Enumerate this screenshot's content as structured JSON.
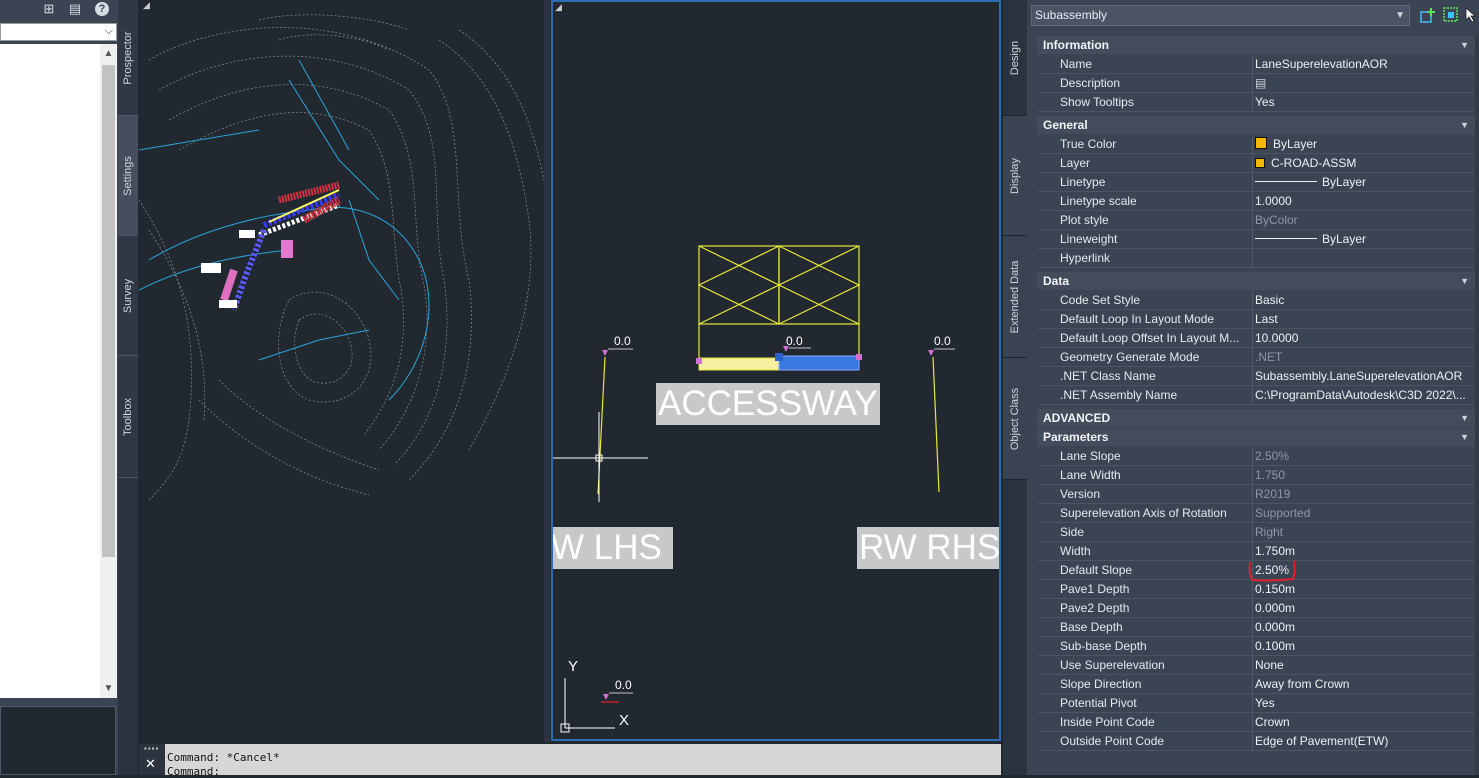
{
  "toolspace": {
    "tabs": [
      "Prospector",
      "Settings",
      "Survey",
      "Toolbox"
    ],
    "active_tab": "Settings",
    "toolbar_icons": [
      "toolbar-icon",
      "palette-icon",
      "help-icon"
    ],
    "help_glyph": "?",
    "combo_value": ""
  },
  "viewport_right": {
    "accessway_label": "ACCESSWAY",
    "lhs_label": "W LHS",
    "rhs_label": "RW RHS",
    "point_values": [
      "0.0",
      "0.0",
      "0.0",
      "0.0"
    ],
    "ucs": {
      "y": "Y",
      "x": "X"
    }
  },
  "command_line": {
    "line1": "Command: *Cancel*",
    "line2": "Command:",
    "close_glyph": "✕"
  },
  "palette_tabs": [
    "Design",
    "Display",
    "Extended Data",
    "Object Class"
  ],
  "properties": {
    "object_type": "Subassembly",
    "sections": {
      "information": {
        "title": "Information",
        "rows": [
          {
            "label": "Name",
            "value": "LaneSuperelevationAOR"
          },
          {
            "label": "Description",
            "value": ""
          },
          {
            "label": "Show Tooltips",
            "value": "Yes"
          }
        ]
      },
      "general": {
        "title": "General",
        "rows": [
          {
            "label": "True Color",
            "value": "ByLayer"
          },
          {
            "label": "Layer",
            "value": "C-ROAD-ASSM"
          },
          {
            "label": "Linetype",
            "value": "ByLayer"
          },
          {
            "label": "Linetype scale",
            "value": "1.0000"
          },
          {
            "label": "Plot style",
            "value": "ByColor"
          },
          {
            "label": "Lineweight",
            "value": "ByLayer"
          },
          {
            "label": "Hyperlink",
            "value": ""
          }
        ]
      },
      "data": {
        "title": "Data",
        "rows": [
          {
            "label": "Code Set Style",
            "value": "Basic"
          },
          {
            "label": "Default Loop In Layout Mode",
            "value": "Last"
          },
          {
            "label": "Default Loop Offset In Layout M...",
            "value": "10.0000"
          },
          {
            "label": "Geometry Generate Mode",
            "value": ".NET"
          },
          {
            "label": ".NET Class Name",
            "value": "Subassembly.LaneSuperelevationAOR"
          },
          {
            "label": ".NET Assembly Name",
            "value": "C:\\ProgramData\\Autodesk\\C3D 2022\\..."
          }
        ]
      },
      "advanced": {
        "title": "ADVANCED"
      },
      "parameters": {
        "title": "Parameters",
        "rows": [
          {
            "label": "Lane Slope",
            "value": "2.50%"
          },
          {
            "label": "Lane Width",
            "value": "1.750"
          },
          {
            "label": "Version",
            "value": "R2019"
          },
          {
            "label": "Superelevation Axis of Rotation",
            "value": "Supported"
          },
          {
            "label": "Side",
            "value": "Right"
          },
          {
            "label": "Width",
            "value": "1.750m"
          },
          {
            "label": "Default Slope",
            "value": "2.50%"
          },
          {
            "label": "Pave1 Depth",
            "value": "0.150m"
          },
          {
            "label": "Pave2 Depth",
            "value": "0.000m"
          },
          {
            "label": "Base Depth",
            "value": "0.000m"
          },
          {
            "label": "Sub-base Depth",
            "value": "0.100m"
          },
          {
            "label": "Use Superelevation",
            "value": "None"
          },
          {
            "label": "Slope Direction",
            "value": "Away from Crown"
          },
          {
            "label": "Potential Pivot",
            "value": "Yes"
          },
          {
            "label": "Inside Point Code",
            "value": "Crown"
          },
          {
            "label": "Outside Point Code",
            "value": "Edge of Pavement(ETW)"
          }
        ]
      }
    }
  },
  "colors": {
    "accent_blue": "#2a6db5",
    "bylayer_yellow": "#f5b800",
    "highlight_red": "#e0202a",
    "cad_yellow": "#e8e83a"
  }
}
